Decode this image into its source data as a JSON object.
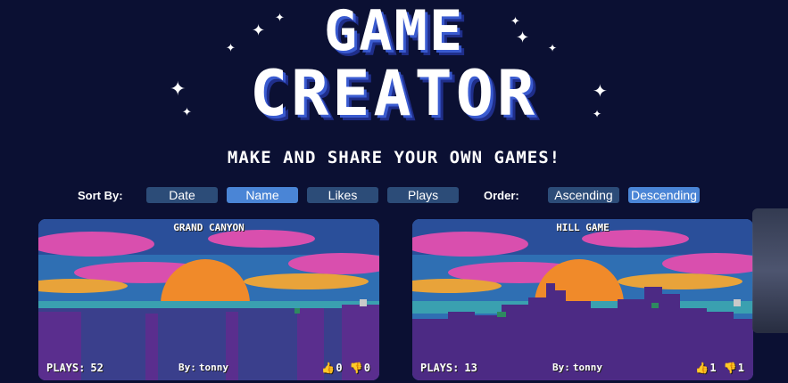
{
  "logo": {
    "line1": "GAME",
    "line2": "CREATOR"
  },
  "tagline": "MAKE AND SHARE YOUR OWN GAMES!",
  "sort": {
    "label": "Sort By:",
    "options": [
      "Date",
      "Name",
      "Likes",
      "Plays"
    ],
    "active": "Name"
  },
  "order": {
    "label": "Order:",
    "options": [
      "Ascending",
      "Descending"
    ],
    "active": "Descending"
  },
  "games": [
    {
      "title": "GRAND CANYON",
      "plays_label": "PLAYS:",
      "plays": "52",
      "by_label": "By:",
      "author": "tonny",
      "likes": "0",
      "dislikes": "0"
    },
    {
      "title": "HILL GAME",
      "plays_label": "PLAYS:",
      "plays": "13",
      "by_label": "By:",
      "author": "tonny",
      "likes": "1",
      "dislikes": "1"
    }
  ],
  "colors": {
    "background": "#0b1033",
    "button": "#2c4c78",
    "button_active": "#4a85d6",
    "sky": "#2f6fb3",
    "sun": "#f08a2a",
    "ground": "#4c2a84",
    "clouds": "#d94fae"
  },
  "icons": [
    "sparkle-icon",
    "thumbs-up-icon",
    "thumbs-down-icon"
  ]
}
